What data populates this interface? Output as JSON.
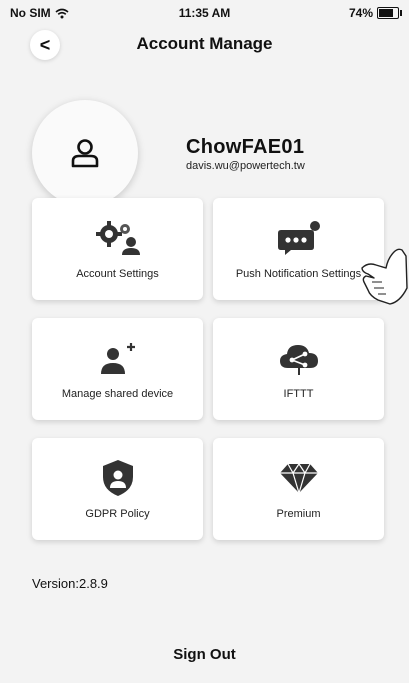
{
  "status": {
    "carrier": "No SIM",
    "time": "11:35 AM",
    "battery": "74%"
  },
  "nav": {
    "title": "Account Manage",
    "back_glyph": "<"
  },
  "profile": {
    "username": "ChowFAE01",
    "email": "davis.wu@powertech.tw"
  },
  "menu": [
    {
      "label": "Account Settings",
      "icon": "settings-gears-user-icon"
    },
    {
      "label": "Push Notification Settings",
      "icon": "chat-notification-icon"
    },
    {
      "label": "Manage shared device",
      "icon": "add-user-icon"
    },
    {
      "label": "IFTTT",
      "icon": "cloud-share-icon"
    },
    {
      "label": "GDPR Policy",
      "icon": "shield-user-icon"
    },
    {
      "label": "Premium",
      "icon": "diamond-icon"
    }
  ],
  "footer": {
    "version": "Version:2.8.9",
    "sign_out": "Sign Out"
  }
}
